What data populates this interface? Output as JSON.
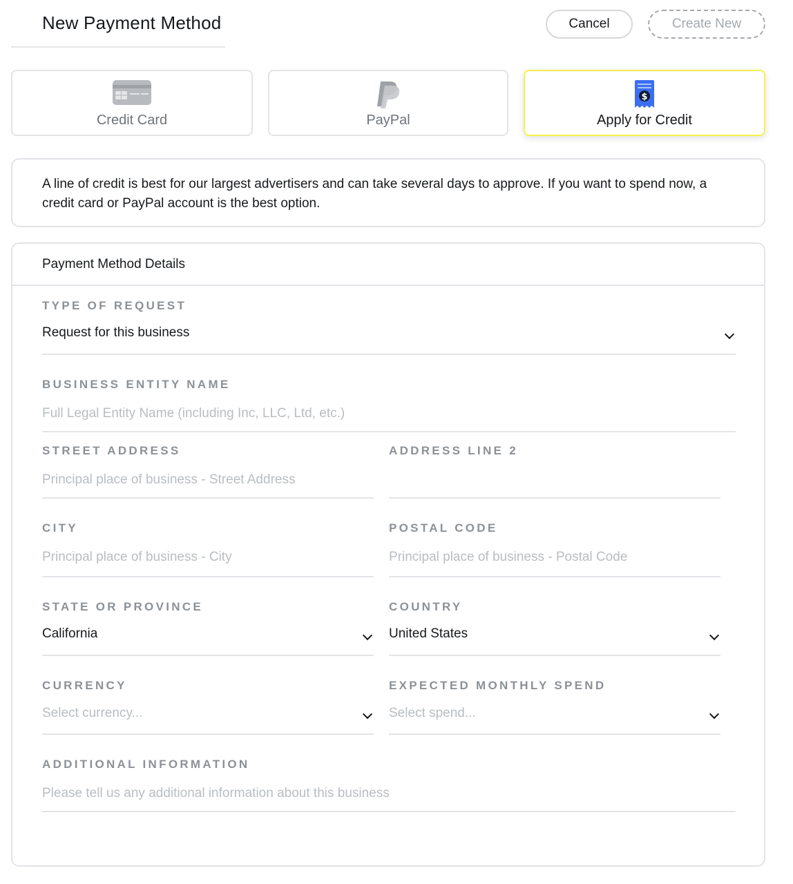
{
  "header": {
    "title": "New Payment Method",
    "cancel_label": "Cancel",
    "create_label": "Create New"
  },
  "payment_methods": [
    {
      "label": "Credit Card",
      "icon": "credit-card-icon",
      "selected": false
    },
    {
      "label": "PayPal",
      "icon": "paypal-icon",
      "selected": false
    },
    {
      "label": "Apply for Credit",
      "icon": "credit-receipt-icon",
      "selected": true
    }
  ],
  "info": {
    "text": "A line of credit is best for our largest advertisers and can take several days to approve. If you want to spend now, a credit card or PayPal account is the best option."
  },
  "details": {
    "title": "Payment Method Details",
    "type_of_request": {
      "label": "TYPE OF REQUEST",
      "value": "Request for this business"
    },
    "business_entity_name": {
      "label": "BUSINESS ENTITY NAME",
      "placeholder": "Full Legal Entity Name (including Inc, LLC, Ltd, etc.)"
    },
    "street_address": {
      "label": "STREET ADDRESS",
      "placeholder": "Principal place of business - Street Address"
    },
    "address_line_2": {
      "label": "ADDRESS LINE 2",
      "placeholder": ""
    },
    "city": {
      "label": "CITY",
      "placeholder": "Principal place of business - City"
    },
    "postal_code": {
      "label": "POSTAL CODE",
      "placeholder": "Principal place of business - Postal Code"
    },
    "state": {
      "label": "STATE OR PROVINCE",
      "value": "California"
    },
    "country": {
      "label": "COUNTRY",
      "value": "United States"
    },
    "currency": {
      "label": "CURRENCY",
      "placeholder": "Select currency..."
    },
    "monthly_spend": {
      "label": "EXPECTED MONTHLY SPEND",
      "placeholder": "Select spend..."
    },
    "additional_info": {
      "label": "ADDITIONAL INFORMATION",
      "placeholder": "Please tell us any additional information about this business"
    }
  },
  "colors": {
    "selected_border": "#f8f14a",
    "label_gray": "#8c9196",
    "placeholder_gray": "#b9bdc1",
    "border_gray": "#e2e4e7",
    "credit_icon_blue": "#3b6ef0"
  }
}
